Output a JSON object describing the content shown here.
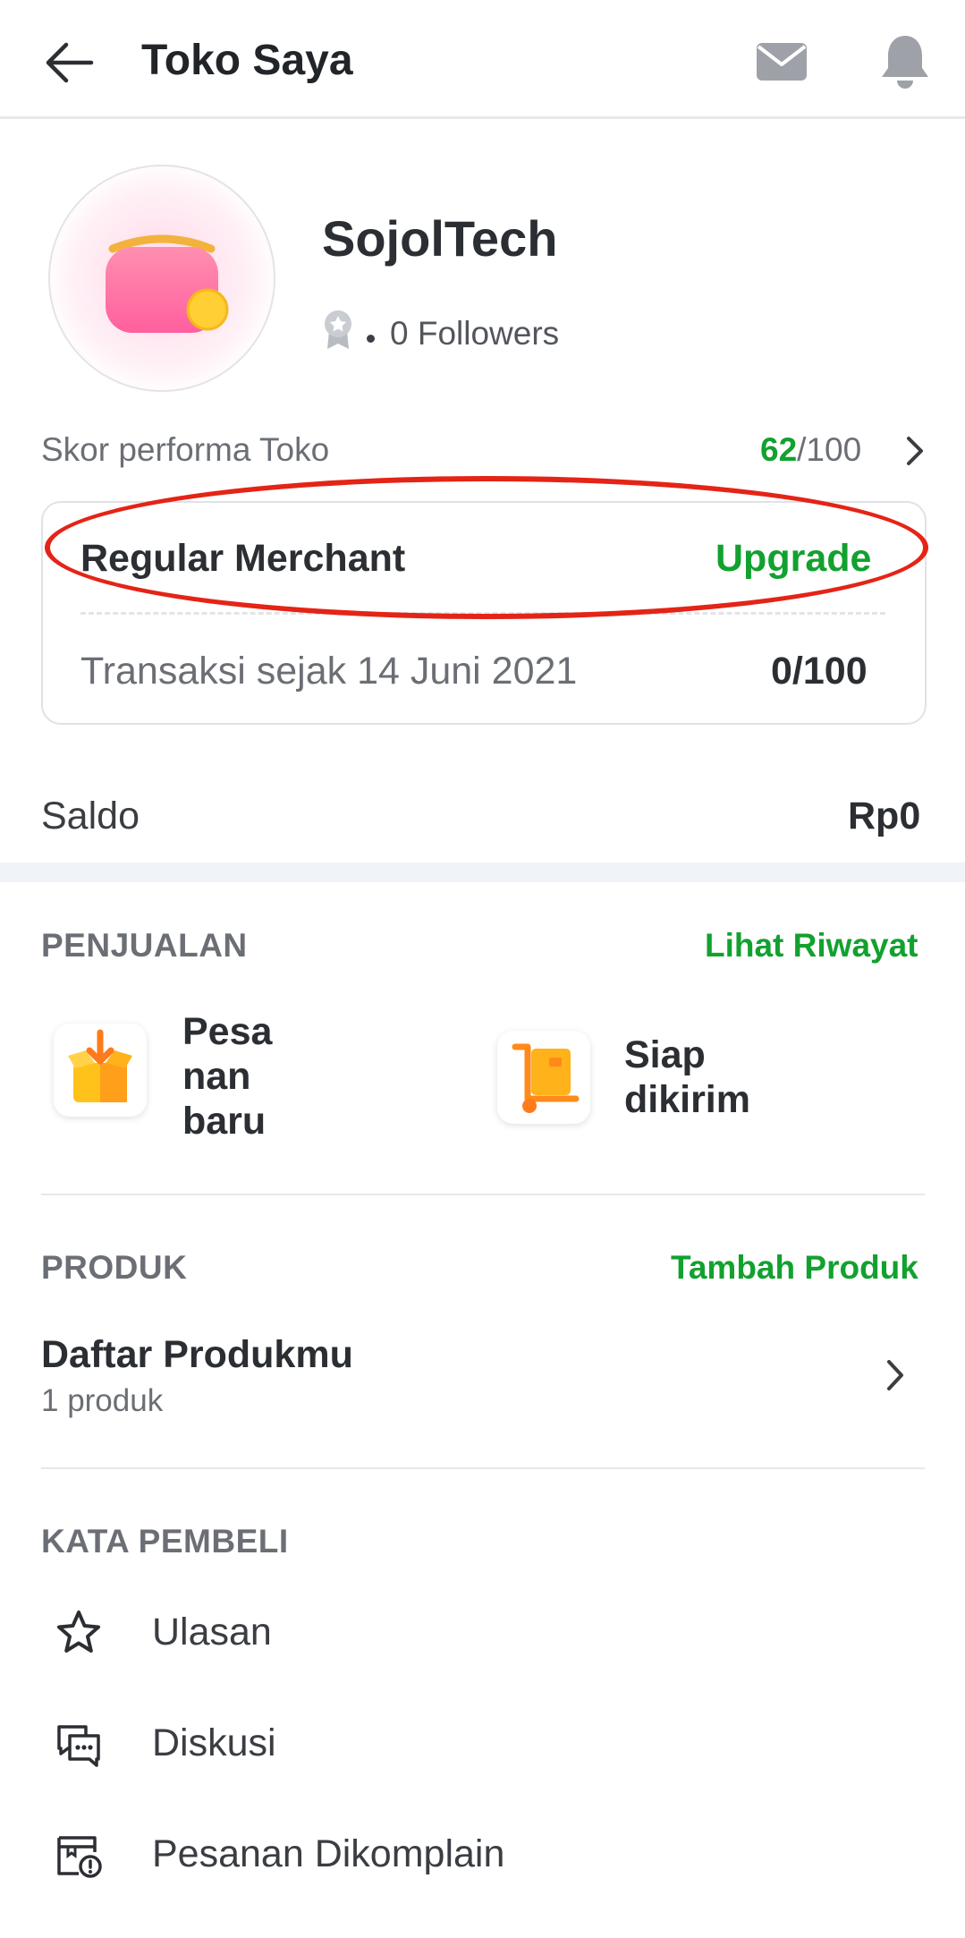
{
  "header": {
    "title": "Toko Saya"
  },
  "profile": {
    "shop_name": "SojolTech",
    "followers": "0 Followers"
  },
  "performance": {
    "label": "Skor performa Toko",
    "score": "62",
    "score_total": "/100"
  },
  "merchant": {
    "tier": "Regular Merchant",
    "upgrade_label": "Upgrade",
    "transactions_label": "Transaksi sejak 14 Juni 2021",
    "transactions_value": "0/100"
  },
  "balance": {
    "label": "Saldo",
    "value": "Rp0"
  },
  "sales": {
    "title": "PENJUALAN",
    "link": "Lihat Riwayat",
    "tiles": [
      {
        "label_lines": [
          "Pesa",
          "nan",
          "baru"
        ],
        "icon": "new-order-box-icon"
      },
      {
        "label_lines": [
          "Siap",
          "dikirim"
        ],
        "icon": "ready-to-ship-cart-icon"
      }
    ]
  },
  "products": {
    "title": "PRODUK",
    "link": "Tambah Produk",
    "list_title": "Daftar Produkmu",
    "list_count": "1 produk"
  },
  "buyer_feedback": {
    "title": "KATA PEMBELI",
    "items": [
      {
        "label": "Ulasan",
        "icon": "star-icon"
      },
      {
        "label": "Diskusi",
        "icon": "chat-bubbles-icon"
      },
      {
        "label": "Pesanan Dikomplain",
        "icon": "complaint-box-icon"
      }
    ]
  },
  "colors": {
    "accent_green": "#12a12f",
    "annotation_red": "#e42416",
    "text_dark": "#2b2e33",
    "text_muted": "#6b6f75"
  }
}
